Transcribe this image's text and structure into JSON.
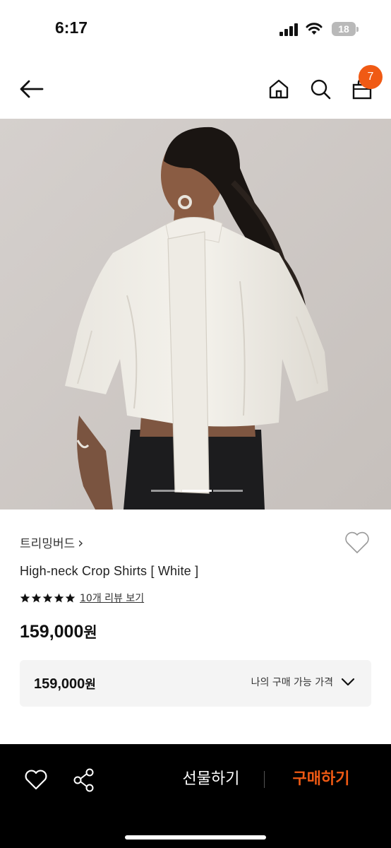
{
  "status_bar": {
    "time": "6:17",
    "battery": "18",
    "icons": [
      "signal-icon",
      "wifi-icon",
      "battery-icon"
    ]
  },
  "nav": {
    "icons": [
      "back-arrow-icon",
      "home-icon",
      "search-icon",
      "shopping-bag-icon"
    ],
    "cart_count": "7"
  },
  "gallery": {
    "image_count": 3,
    "active_index": 1
  },
  "product": {
    "brand": "트리밍버드",
    "brand_chevron": "›",
    "name": "High-neck Crop Shirts [ White ]",
    "rating_stars": 5,
    "review_link": "10개 리뷰 보기",
    "price": "159,000",
    "currency": "원"
  },
  "price_box": {
    "price": "159,000",
    "currency": "원",
    "toggle_label": "나의 구매 가능 가격"
  },
  "bottom_bar": {
    "gift_label": "선물하기",
    "buy_label": "구매하기",
    "icons": [
      "heart-icon",
      "share-icon"
    ]
  },
  "colors": {
    "accent": "#f05a14",
    "bottom_bar_bg": "#000000",
    "price_box_bg": "#f4f4f4"
  }
}
